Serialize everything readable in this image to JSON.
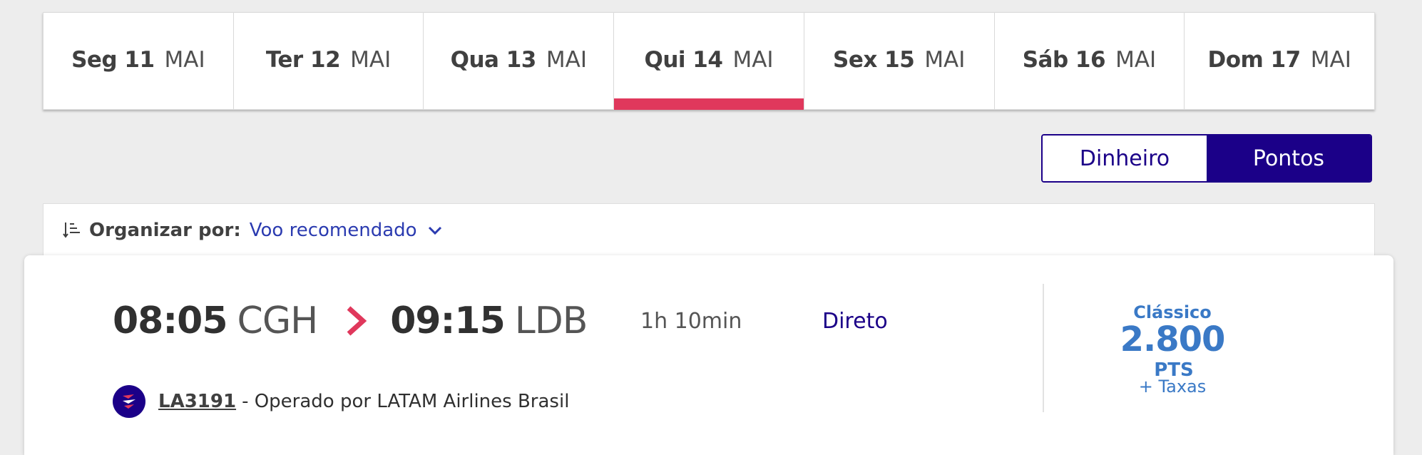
{
  "date_tabs": [
    {
      "day": "Seg 11",
      "month": "MAI",
      "active": false
    },
    {
      "day": "Ter 12",
      "month": "MAI",
      "active": false
    },
    {
      "day": "Qua 13",
      "month": "MAI",
      "active": false
    },
    {
      "day": "Qui 14",
      "month": "MAI",
      "active": true
    },
    {
      "day": "Sex 15",
      "month": "MAI",
      "active": false
    },
    {
      "day": "Sáb 16",
      "month": "MAI",
      "active": false
    },
    {
      "day": "Dom 17",
      "month": "MAI",
      "active": false
    }
  ],
  "currency_toggle": {
    "money_label": "Dinheiro",
    "points_label": "Pontos",
    "selected": "Pontos"
  },
  "sort": {
    "label": "Organizar por:",
    "value": "Voo recomendado",
    "icon": "sort-icon"
  },
  "flight": {
    "departure_time": "08:05",
    "departure_airport": "CGH",
    "arrival_time": "09:15",
    "arrival_airport": "LDB",
    "duration": "1h 10min",
    "stops": "Direto",
    "flight_number": "LA3191",
    "operated_by": "- Operado por LATAM Airlines Brasil",
    "fare_name": "Clássico",
    "price": "2.800",
    "price_unit": "PTS",
    "taxes": "+ Taxas"
  },
  "colors": {
    "accent_red": "#e0385c",
    "brand_navy": "#1b0088",
    "price_blue": "#3a79c6",
    "link_blue": "#2b3bb0"
  }
}
